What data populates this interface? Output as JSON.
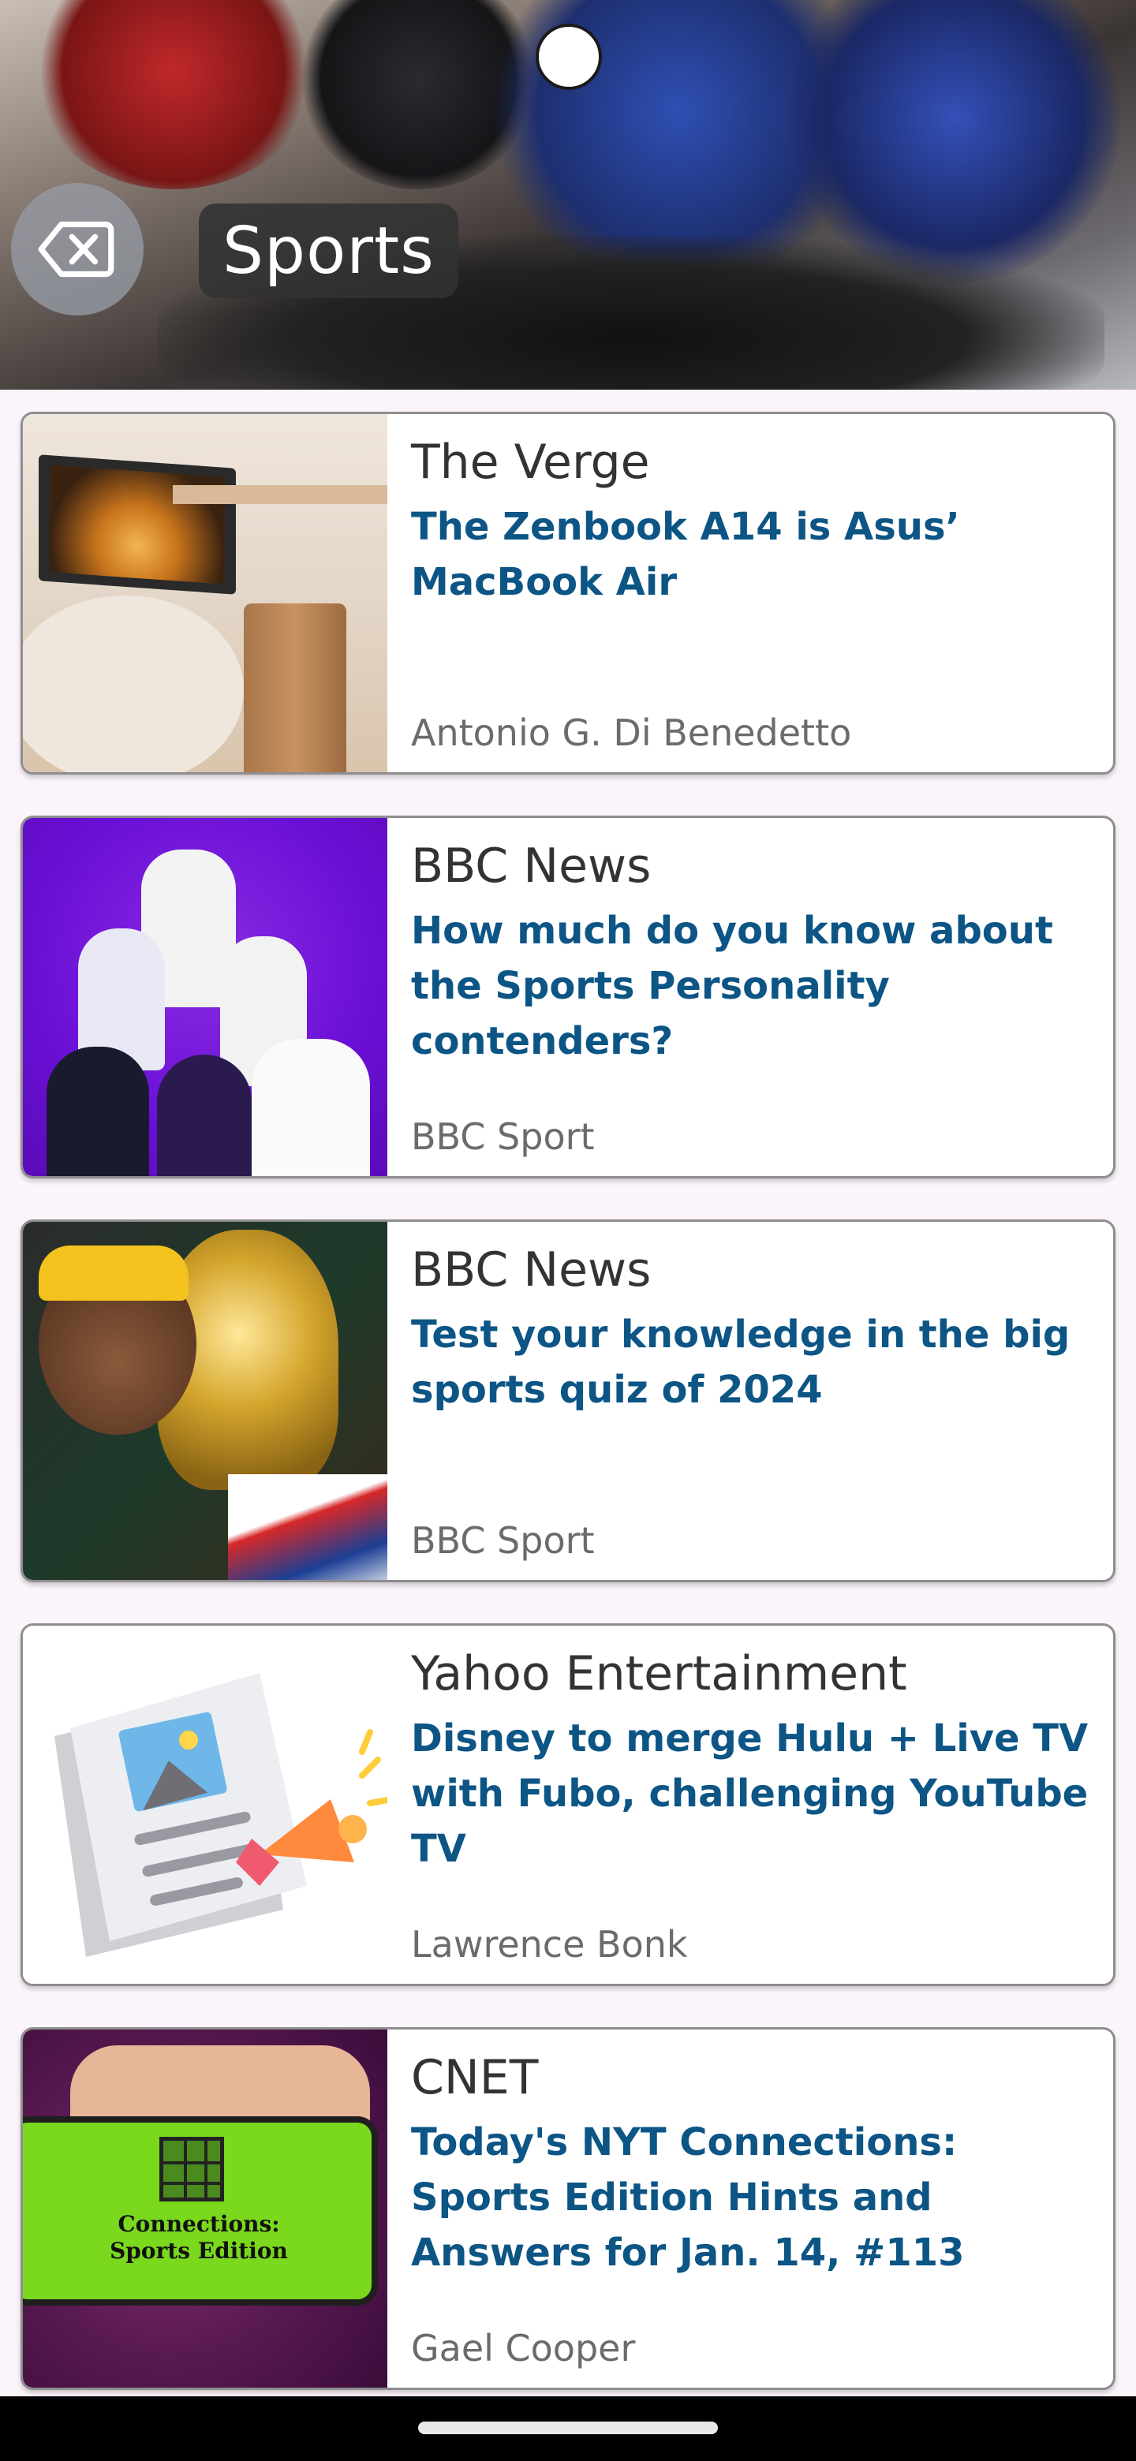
{
  "header": {
    "title": "Sports"
  },
  "articles": [
    {
      "source": "The Verge",
      "headline": "The Zenbook A14 is Asus’ MacBook Air",
      "author": "Antonio G. Di Benedetto",
      "image": "laptop-photo"
    },
    {
      "source": "BBC News",
      "headline": "How much do you know about the Sports Personality contenders?",
      "author": "BBC Sport",
      "image": "athletes-collage"
    },
    {
      "source": "BBC News",
      "headline": "Test your knowledge in the big sports quiz of 2024",
      "author": "BBC Sport",
      "image": "trophy-photo"
    },
    {
      "source": "Yahoo Entertainment",
      "headline": "Disney to merge Hulu + Live TV with Fubo, challenging YouTube TV",
      "author": "Lawrence Bonk",
      "image": "newspaper-icon"
    },
    {
      "source": "CNET",
      "headline": "Today's NYT Connections: Sports Edition Hints and Answers for Jan. 14, #113",
      "author": "Gael Cooper",
      "image": "connections-phone",
      "image_caption": "Connections: Sports Edition"
    }
  ],
  "colors": {
    "headline": "#0c5585",
    "background": "#fbf4fb"
  }
}
